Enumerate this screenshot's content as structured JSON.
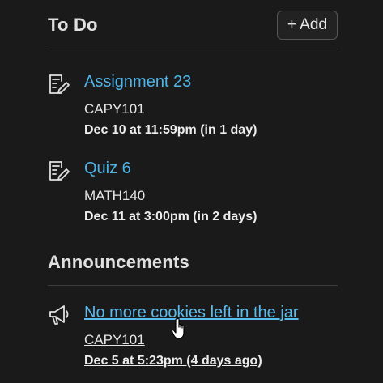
{
  "todo": {
    "title": "To Do",
    "add_label": "+ Add",
    "items": [
      {
        "icon": "assignment-icon",
        "title": "Assignment 23",
        "course": "CAPY101",
        "due": "Dec 10 at 11:59pm (in 1 day)"
      },
      {
        "icon": "quiz-icon",
        "title": "Quiz 6",
        "course": "MATH140",
        "due": "Dec 11 at 3:00pm (in 2 days)"
      }
    ]
  },
  "announcements": {
    "title": "Announcements",
    "items": [
      {
        "icon": "megaphone-icon",
        "title": "No more cookies left in the jar",
        "course": "CAPY101",
        "date": "Dec 5 at 5:23pm (4 days ago)"
      }
    ]
  },
  "colors": {
    "background": "#1a1a1a",
    "link": "#4fb3e8",
    "divider": "#3c3c3c"
  }
}
